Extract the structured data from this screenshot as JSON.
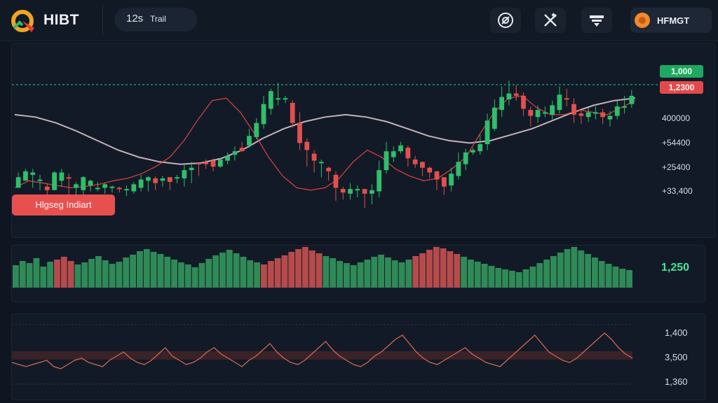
{
  "app": {
    "brand": "HIBT",
    "user_label": "HFMGT"
  },
  "toolbar": {
    "interval_value": "12s",
    "interval_mode": "Trail",
    "icons": [
      "compass-icon",
      "tools-icon",
      "layout-icon"
    ]
  },
  "price_tags": {
    "last": "1,000",
    "mark": "1,2300"
  },
  "price_axis": [
    "400000",
    "+54400",
    "+25400",
    "+33,400"
  ],
  "overlay_button": "Hlgseg Indiart",
  "volume": {
    "current": "1,250"
  },
  "oscillator_axis": [
    "1,400",
    "3,500",
    "1,360"
  ],
  "colors": {
    "bull": "#2fbf6b",
    "bear": "#e2504e",
    "accent_line": "#1fc98e"
  },
  "chart_data": {
    "type": "candlestick",
    "candles": [
      [
        150,
        159,
        133,
        163,
        154
      ],
      [
        156,
        164,
        150,
        166,
        158
      ],
      [
        161,
        163,
        149,
        166,
        150
      ],
      [
        156,
        157,
        151,
        161,
        148
      ],
      [
        151,
        148,
        143,
        154,
        144
      ],
      [
        148,
        163,
        156,
        164,
        151
      ],
      [
        156,
        163,
        155,
        166,
        151
      ],
      [
        159,
        158,
        149,
        162,
        144
      ],
      [
        150,
        153,
        147,
        155,
        142
      ],
      [
        148,
        159,
        153,
        160,
        143
      ],
      [
        152,
        156,
        151,
        157,
        147
      ],
      [
        149,
        150,
        148,
        155,
        147
      ],
      [
        150,
        153,
        149,
        154,
        145
      ],
      [
        150,
        151,
        148,
        152,
        146
      ],
      [
        150,
        149,
        148,
        151,
        146
      ],
      [
        149,
        149,
        146,
        152,
        143
      ],
      [
        147,
        153,
        150,
        155,
        145
      ],
      [
        150,
        157,
        155,
        161,
        147
      ],
      [
        156,
        159,
        156,
        160,
        147
      ],
      [
        158,
        154,
        150,
        160,
        148
      ],
      [
        156,
        158,
        153,
        160,
        151
      ],
      [
        159,
        155,
        151,
        159,
        148
      ],
      [
        158,
        159,
        157,
        161,
        154
      ],
      [
        158,
        165,
        162,
        170,
        151
      ],
      [
        165,
        167,
        165,
        172,
        154
      ],
      [
        171,
        170,
        168,
        170,
        160
      ],
      [
        172,
        170,
        171,
        174,
        166
      ],
      [
        173,
        168,
        171,
        175,
        164
      ],
      [
        168,
        174,
        172,
        175,
        167
      ],
      [
        173,
        177,
        176,
        180,
        170
      ],
      [
        178,
        181,
        181,
        185,
        173
      ],
      [
        184,
        181,
        186,
        189,
        181
      ],
      [
        186,
        194,
        191,
        200,
        184
      ],
      [
        193,
        205,
        204,
        209,
        191
      ],
      [
        204,
        221,
        216,
        228,
        200
      ],
      [
        217,
        232,
        226,
        234,
        212
      ],
      [
        225,
        226,
        224,
        239,
        220
      ],
      [
        226,
        226,
        225,
        228,
        222
      ],
      [
        222,
        205,
        204,
        224,
        201
      ],
      [
        205,
        188,
        189,
        214,
        182
      ],
      [
        189,
        182,
        178,
        192,
        168
      ],
      [
        179,
        173,
        171,
        182,
        163
      ],
      [
        171,
        172,
        166,
        174,
        159
      ],
      [
        167,
        164,
        161,
        168,
        156
      ],
      [
        161,
        150,
        150,
        164,
        139
      ],
      [
        149,
        146,
        145,
        151,
        140
      ],
      [
        145,
        149,
        146,
        154,
        140
      ],
      [
        149,
        149,
        148,
        152,
        142
      ],
      [
        149,
        145,
        145,
        147,
        133
      ],
      [
        145,
        148,
        145,
        153,
        136
      ],
      [
        147,
        165,
        162,
        173,
        142
      ],
      [
        165,
        181,
        176,
        189,
        162
      ],
      [
        176,
        181,
        180,
        185,
        172
      ],
      [
        181,
        186,
        185,
        189,
        179
      ],
      [
        184,
        175,
        175,
        186,
        168
      ],
      [
        174,
        170,
        171,
        177,
        167
      ],
      [
        172,
        167,
        166,
        172,
        160
      ],
      [
        167,
        163,
        164,
        168,
        158
      ],
      [
        164,
        157,
        158,
        164,
        148
      ],
      [
        159,
        151,
        153,
        158,
        144
      ],
      [
        152,
        162,
        159,
        167,
        147
      ],
      [
        160,
        172,
        170,
        180,
        157
      ],
      [
        170,
        180,
        180,
        183,
        165
      ],
      [
        180,
        182,
        181,
        184,
        178
      ],
      [
        181,
        187,
        187,
        195,
        178
      ],
      [
        187,
        207,
        200,
        213,
        182
      ],
      [
        200,
        218,
        215,
        225,
        198
      ],
      [
        216,
        227,
        225,
        236,
        210
      ],
      [
        225,
        230,
        230,
        241,
        220
      ],
      [
        230,
        228,
        228,
        237,
        224
      ],
      [
        228,
        217,
        214,
        231,
        211
      ],
      [
        216,
        211,
        209,
        219,
        202
      ],
      [
        210,
        216,
        212,
        220,
        205
      ],
      [
        214,
        214,
        212,
        219,
        210
      ],
      [
        212,
        220,
        216,
        224,
        208
      ],
      [
        216,
        229,
        226,
        236,
        213
      ],
      [
        226,
        225,
        223,
        234,
        219
      ],
      [
        221,
        212,
        212,
        226,
        205
      ],
      [
        213,
        211,
        208,
        215,
        204
      ],
      [
        210,
        214,
        213,
        218,
        206
      ],
      [
        214,
        214,
        213,
        219,
        208
      ],
      [
        214,
        210,
        208,
        217,
        204
      ],
      [
        208,
        211,
        210,
        215,
        202
      ],
      [
        211,
        219,
        218,
        224,
        208
      ],
      [
        218,
        219,
        219,
        228,
        213
      ],
      [
        221,
        228,
        230,
        233,
        218
      ]
    ],
    "moving_averages": [
      {
        "name": "slow",
        "color": "#d9c3c9",
        "values": [
          212,
          210,
          205,
          198,
          190,
          182,
          176,
          172,
          170,
          171,
          175,
          182,
          192,
          200,
          206,
          210,
          212,
          210,
          206,
          200,
          194,
          190,
          188,
          190,
          195,
          200,
          207,
          214,
          220,
          224,
          226
        ]
      },
      {
        "name": "fast",
        "color": "#e3463f",
        "values": [
          150,
          156,
          154,
          152,
          150,
          151,
          153,
          156,
          158,
          162,
          168,
          176,
          190,
          208,
          224,
          226,
          214,
          196,
          176,
          160,
          150,
          148,
          150,
          158,
          172,
          182,
          176,
          166,
          160,
          156,
          158,
          166,
          176,
          196,
          214,
          226,
          228,
          218,
          212,
          212,
          216,
          214,
          212,
          218,
          224
        ]
      }
    ],
    "volume_bars": [
      32,
      38,
      35,
      42,
      30,
      37,
      40,
      44,
      38,
      33,
      36,
      41,
      45,
      39,
      34,
      37,
      43,
      47,
      52,
      55,
      51,
      48,
      44,
      40,
      36,
      33,
      29,
      35,
      41,
      46,
      50,
      54,
      49,
      44,
      39,
      36,
      33,
      38,
      42,
      46,
      51,
      55,
      58,
      53,
      49,
      45,
      42,
      38,
      35,
      32,
      36,
      40,
      44,
      47,
      43,
      39,
      36,
      40,
      45,
      49,
      54,
      58,
      56,
      52,
      48,
      44,
      40,
      37,
      34,
      31,
      28,
      26,
      24,
      22,
      26,
      30,
      35,
      40,
      45,
      50,
      55,
      58,
      53,
      48,
      43,
      38,
      34,
      30,
      27,
      25
    ],
    "oscillator": [
      15,
      14,
      13,
      14,
      15,
      16,
      13,
      12,
      14,
      16,
      17,
      15,
      14,
      13,
      16,
      18,
      20,
      17,
      15,
      14,
      16,
      19,
      22,
      18,
      16,
      14,
      15,
      17,
      20,
      22,
      19,
      17,
      15,
      13,
      16,
      18,
      21,
      24,
      20,
      17,
      15,
      14,
      16,
      19,
      22,
      25,
      21,
      18,
      16,
      14,
      13,
      15,
      18,
      20,
      23,
      26,
      28,
      24,
      20,
      17,
      15,
      14,
      16,
      18,
      20,
      22,
      19,
      17,
      15,
      14,
      13,
      16,
      19,
      22,
      25,
      28,
      24,
      20,
      18,
      16,
      15,
      17,
      20,
      23,
      26,
      29,
      26,
      22,
      19,
      17
    ],
    "ylim": [
      120,
      260
    ]
  }
}
